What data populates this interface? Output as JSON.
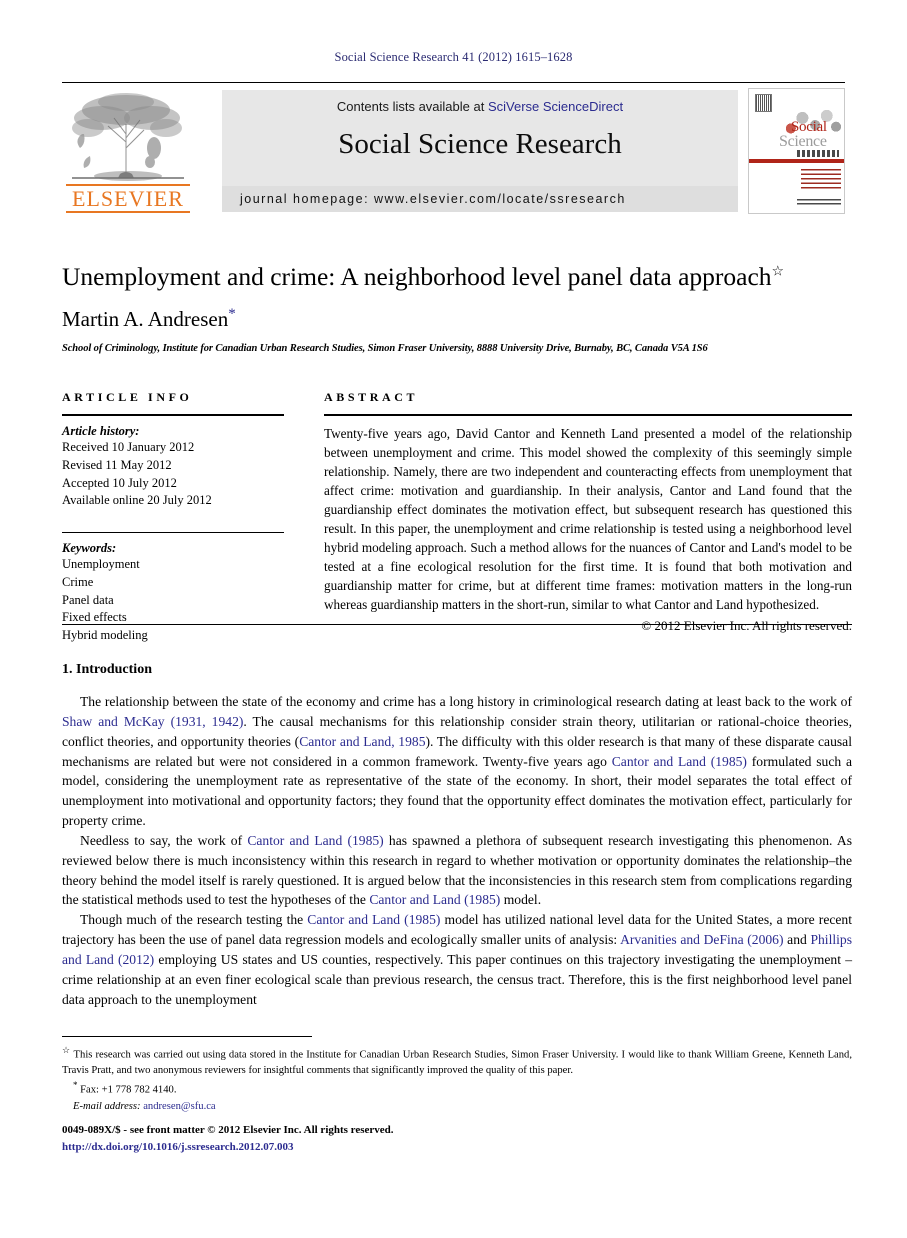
{
  "running_head": "Social Science Research 41 (2012) 1615–1628",
  "masthead": {
    "elsevier_wordmark": "ELSEVIER",
    "contents_prefix": "Contents lists available at ",
    "contents_link": "SciVerse ScienceDirect",
    "journal_title": "Social Science Research",
    "homepage": "journal homepage: www.elsevier.com/locate/ssresearch",
    "cover": {
      "line1": "Social",
      "line2": "Science",
      "line3": "RESEARCH"
    }
  },
  "article": {
    "title": "Unemployment and crime: A neighborhood level panel data approach",
    "title_footnote_mark": "☆",
    "author": "Martin A. Andresen",
    "author_corr_mark": "*",
    "affiliation": "School of Criminology, Institute for Canadian Urban Research Studies, Simon Fraser University, 8888 University Drive, Burnaby, BC, Canada V5A 1S6"
  },
  "info": {
    "heading": "ARTICLE INFO",
    "history_label": "Article history:",
    "history": [
      "Received 10 January 2012",
      "Revised 11 May 2012",
      "Accepted 10 July 2012",
      "Available online 20 July 2012"
    ],
    "keywords_label": "Keywords:",
    "keywords": [
      "Unemployment",
      "Crime",
      "Panel data",
      "Fixed effects",
      "Hybrid modeling"
    ]
  },
  "abstract": {
    "heading": "ABSTRACT",
    "text": "Twenty-five years ago, David Cantor and Kenneth Land presented a model of the relationship between unemployment and crime. This model showed the complexity of this seemingly simple relationship. Namely, there are two independent and counteracting effects from unemployment that affect crime: motivation and guardianship. In their analysis, Cantor and Land found that the guardianship effect dominates the motivation effect, but subsequent research has questioned this result. In this paper, the unemployment and crime relationship is tested using a neighborhood level hybrid modeling approach. Such a method allows for the nuances of Cantor and Land's model to be tested at a fine ecological resolution for the first time. It is found that both motivation and guardianship matter for crime, but at different time frames: motivation matters in the long-run whereas guardianship matters in the short-run, similar to what Cantor and Land hypothesized.",
    "copyright": "© 2012 Elsevier Inc. All rights reserved."
  },
  "body": {
    "section_heading": "1. Introduction",
    "paragraphs": [
      {
        "runs": [
          {
            "t": "The relationship between the state of the economy and crime has a long history in criminological research dating at least back to the work of "
          },
          {
            "t": "Shaw and McKay (1931, 1942)",
            "link": true
          },
          {
            "t": ". The causal mechanisms for this relationship consider strain theory, utilitarian or rational-choice theories, conflict theories, and opportunity theories ("
          },
          {
            "t": "Cantor and Land, 1985",
            "link": true
          },
          {
            "t": "). The difficulty with this older research is that many of these disparate causal mechanisms are related but were not considered in a common framework. Twenty-five years ago "
          },
          {
            "t": "Cantor and Land (1985)",
            "link": true
          },
          {
            "t": " formulated such a model, considering the unemployment rate as representative of the state of the economy. In short, their model separates the total effect of unemployment into motivational and opportunity factors; they found that the opportunity effect dominates the motivation effect, particularly for property crime."
          }
        ]
      },
      {
        "runs": [
          {
            "t": "Needless to say, the work of "
          },
          {
            "t": "Cantor and Land (1985)",
            "link": true
          },
          {
            "t": " has spawned a plethora of subsequent research investigating this phenomenon. As reviewed below there is much inconsistency within this research in regard to whether motivation or opportunity dominates the relationship–the theory behind the model itself is rarely questioned. It is argued below that the inconsistencies in this research stem from complications regarding the statistical methods used to test the hypotheses of the "
          },
          {
            "t": "Cantor and Land (1985)",
            "link": true
          },
          {
            "t": " model."
          }
        ]
      },
      {
        "runs": [
          {
            "t": "Though much of the research testing the "
          },
          {
            "t": "Cantor and Land (1985)",
            "link": true
          },
          {
            "t": " model has utilized national level data for the United States, a more recent trajectory has been the use of panel data regression models and ecologically smaller units of analysis: "
          },
          {
            "t": "Arvanities and DeFina (2006)",
            "link": true
          },
          {
            "t": " and "
          },
          {
            "t": "Phillips and Land (2012)",
            "link": true
          },
          {
            "t": " employing US states and US counties, respectively. This paper continues on this trajectory investigating the unemployment – crime relationship at an even finer ecological scale than previous research, the census tract. Therefore, this is the first neighborhood level panel data approach to the unemployment"
          }
        ]
      }
    ]
  },
  "footnotes": {
    "star_mark": "☆",
    "star_text": "This research was carried out using data stored in the Institute for Canadian Urban Research Studies, Simon Fraser University. I would like to thank William Greene, Kenneth Land, Travis Pratt, and two anonymous reviewers for insightful comments that significantly improved the quality of this paper.",
    "corr_mark": "*",
    "corr_text": "Fax: +1 778 782 4140.",
    "email_label": "E-mail address:",
    "email": "andresen@sfu.ca"
  },
  "imprint": {
    "line1": "0049-089X/$ - see front matter © 2012 Elsevier Inc. All rights reserved.",
    "doi": "http://dx.doi.org/10.1016/j.ssresearch.2012.07.003"
  },
  "colors": {
    "link": "#2b2b8f",
    "running_head": "#2b2b72",
    "elsevier_orange": "#e87722",
    "banner_gray": "#e7e7e7",
    "cover_red": "#b02418"
  }
}
